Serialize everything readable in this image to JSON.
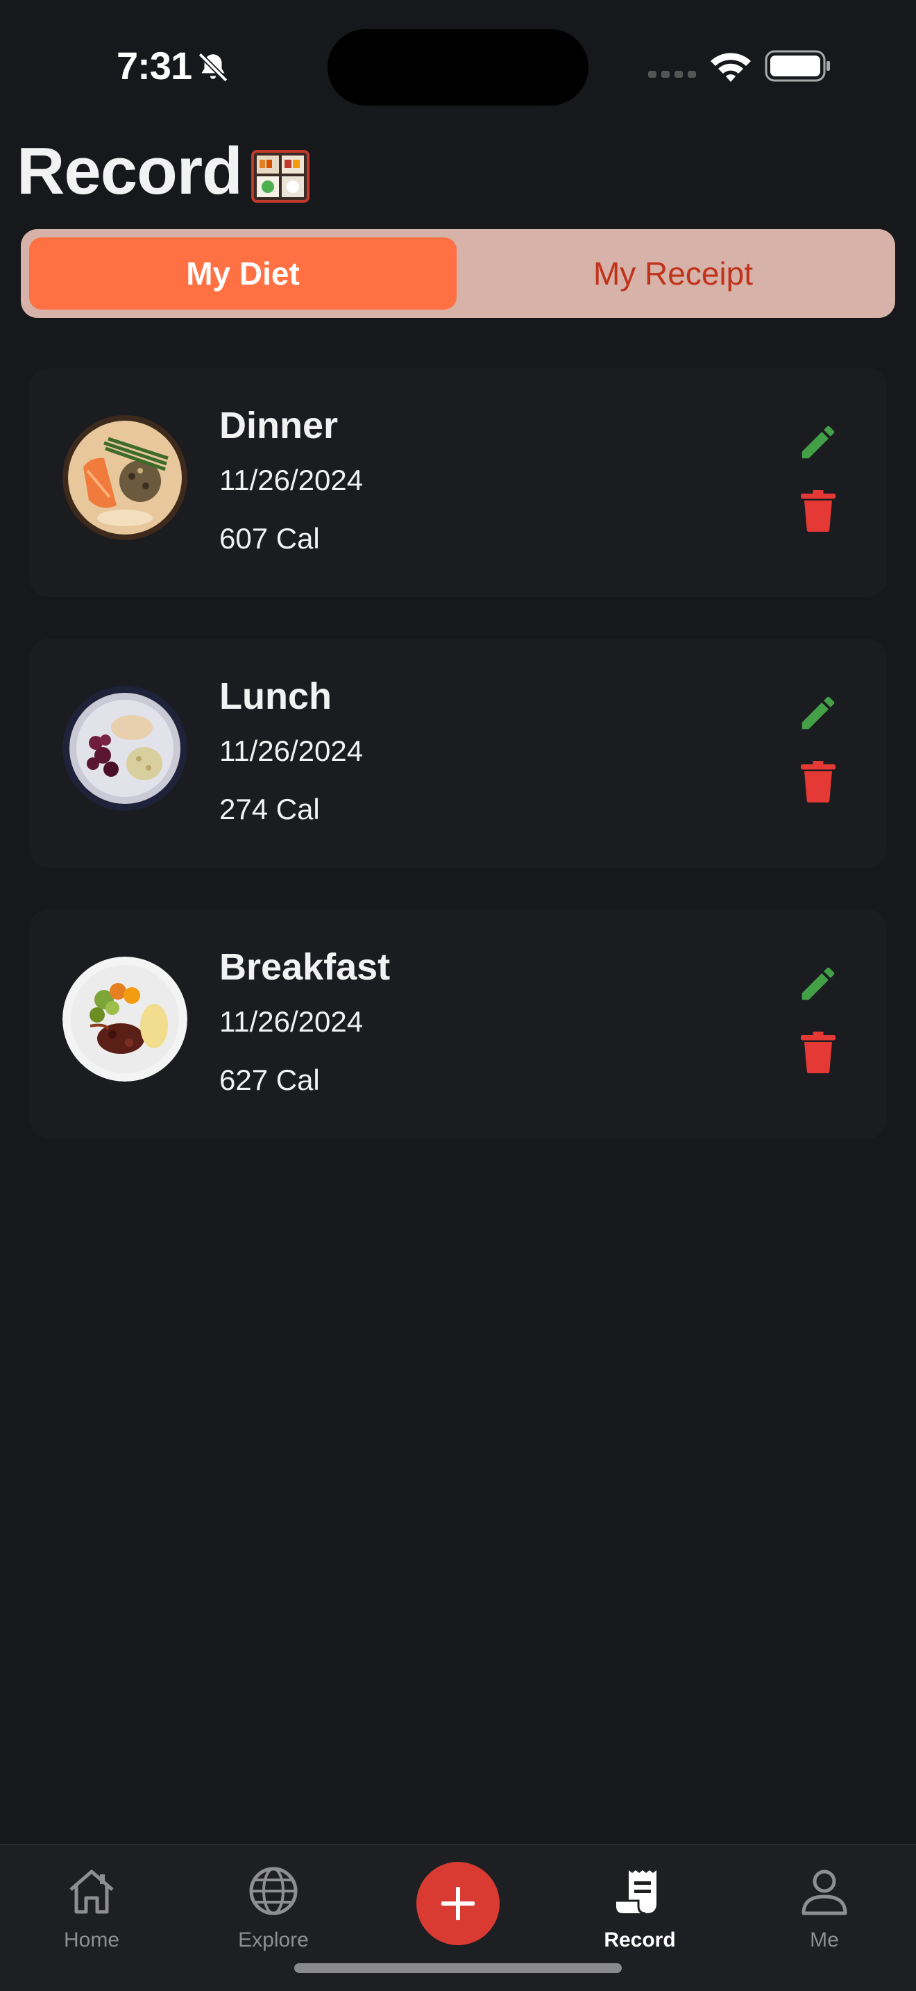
{
  "status_bar": {
    "time": "7:31",
    "icons": [
      "bell-slash-icon",
      "cellular-signal-icon",
      "wifi-icon",
      "battery-icon"
    ]
  },
  "page": {
    "title": "Record",
    "title_emoji_icon": "bento-box-icon"
  },
  "segment": {
    "tabs": [
      {
        "label": "My Diet",
        "active": true
      },
      {
        "label": "My Receipt",
        "active": false
      }
    ]
  },
  "meals": [
    {
      "name": "Dinner",
      "date": "11/26/2024",
      "calories": "607 Cal",
      "image_icon": "salmon-plate-icon"
    },
    {
      "name": "Lunch",
      "date": "11/26/2024",
      "calories": "274 Cal",
      "image_icon": "beet-chicken-plate-icon"
    },
    {
      "name": "Breakfast",
      "date": "11/26/2024",
      "calories": "627 Cal",
      "image_icon": "meat-veg-plate-icon"
    }
  ],
  "tabbar": {
    "items": [
      {
        "label": "Home",
        "icon": "home-icon"
      },
      {
        "label": "Explore",
        "icon": "globe-icon"
      },
      {
        "label": "",
        "icon": "plus-icon"
      },
      {
        "label": "Record",
        "icon": "receipt-icon",
        "active": true
      },
      {
        "label": "Me",
        "icon": "person-icon"
      }
    ]
  },
  "colors": {
    "background": "#17181b",
    "accent": "#ff7043",
    "segment_bg": "#d6b2a8",
    "edit": "#43a047",
    "delete": "#e53935",
    "add_button": "#d93b33"
  }
}
